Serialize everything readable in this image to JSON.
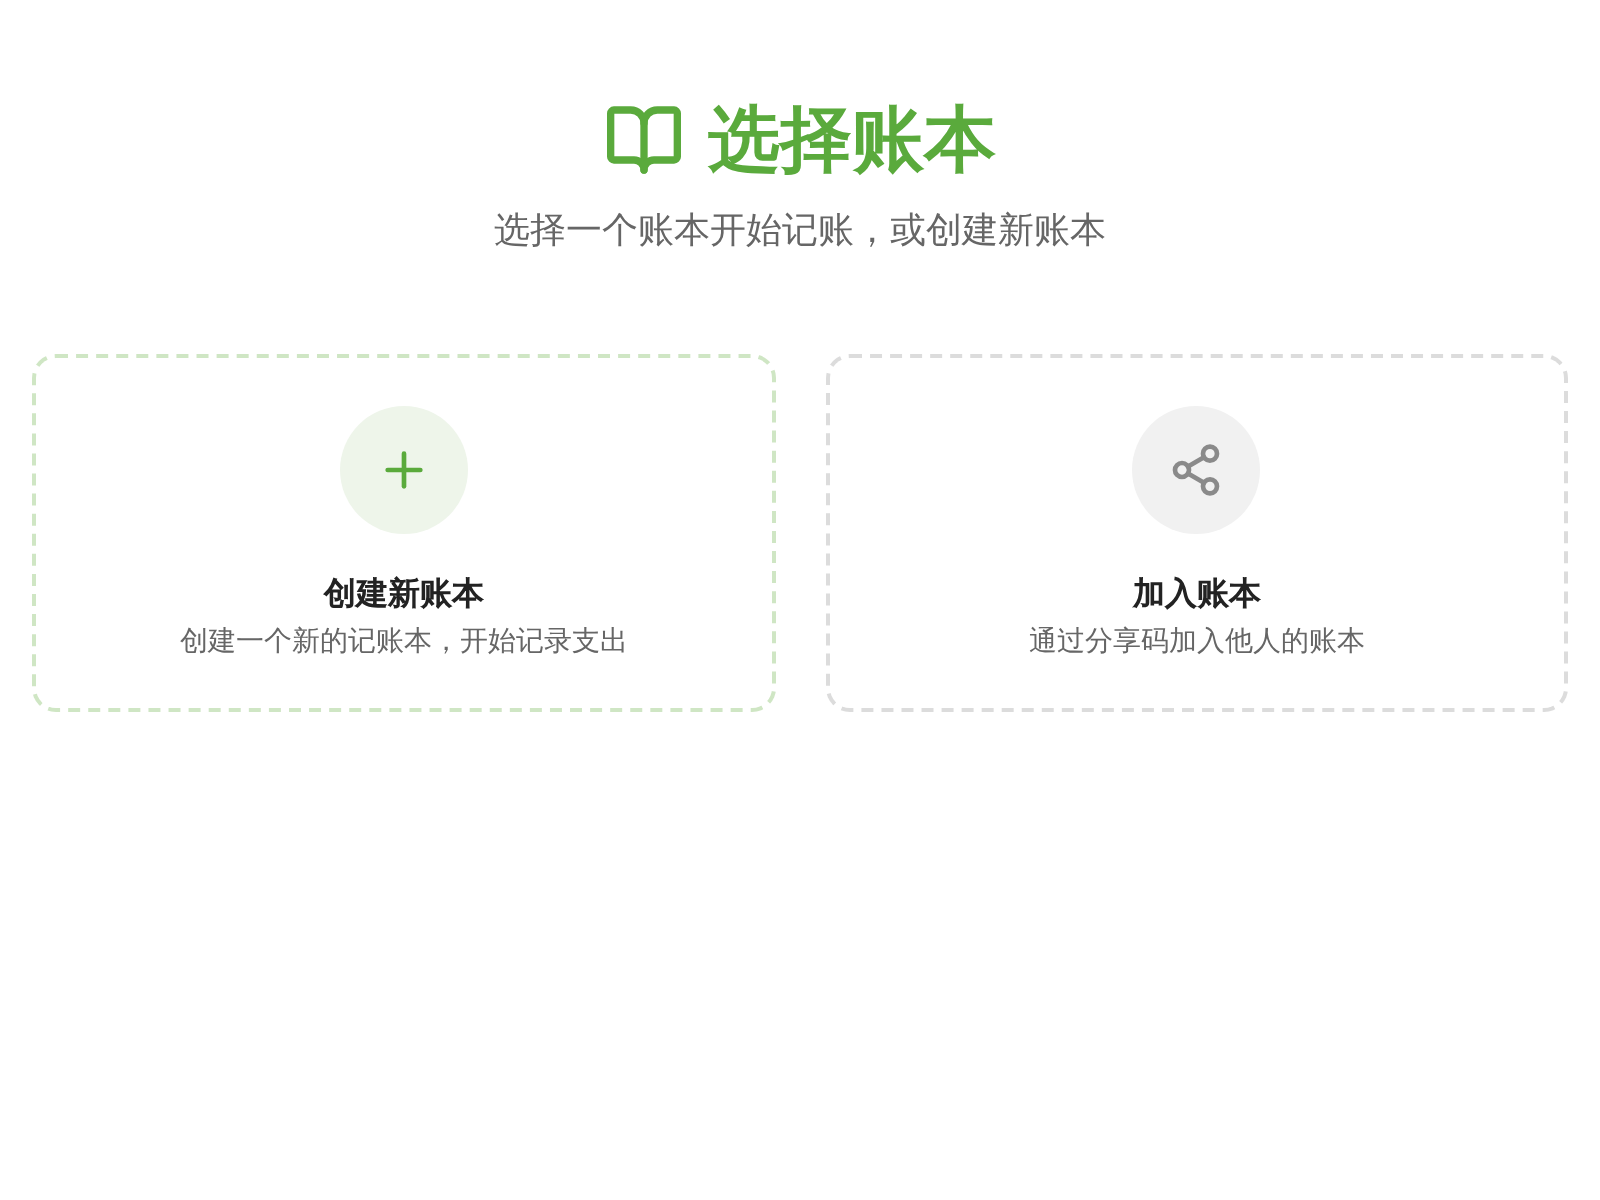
{
  "header": {
    "title": "选择账本",
    "subtitle": "选择一个账本开始记账，或创建新账本"
  },
  "cards": [
    {
      "kind": "create",
      "title": "创建新账本",
      "description": "创建一个新的记账本，开始记录支出"
    },
    {
      "kind": "join",
      "title": "加入账本",
      "description": "通过分享码加入他人的账本"
    }
  ]
}
